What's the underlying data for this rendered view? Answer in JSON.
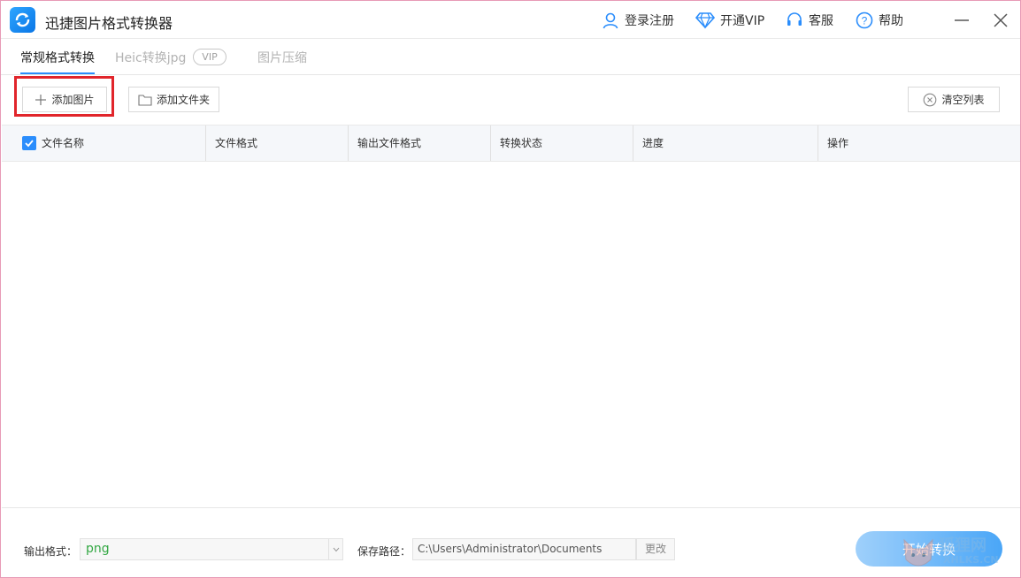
{
  "app": {
    "title": "迅捷图片格式转换器"
  },
  "topnav": {
    "login": "登录注册",
    "vip": "开通VIP",
    "service": "客服",
    "help": "帮助"
  },
  "tabs": [
    {
      "label": "常规格式转换"
    },
    {
      "label": "Heic转换jpg"
    },
    {
      "label": "图片压缩"
    }
  ],
  "vip_badge": "VIP",
  "toolbar": {
    "add_image": "添加图片",
    "add_folder": "添加文件夹",
    "clear_list": "清空列表"
  },
  "table": {
    "columns": [
      "文件名称",
      "文件格式",
      "输出文件格式",
      "转换状态",
      "进度",
      "操作"
    ],
    "select_all_checked": true
  },
  "footer": {
    "output_format_label": "输出格式：",
    "output_format_value": "png",
    "save_path_label": "保存路径：",
    "save_path_value": "C:\\Users\\Administrator\\Documents",
    "change_label": "更改",
    "start_label": "开始转换"
  },
  "watermark": {
    "text1": "狐狸网",
    "text2": "XHLKS.CN"
  },
  "colors": {
    "accent": "#2a8dfc",
    "highlight": "#e1252b",
    "format_value": "#34a844"
  }
}
